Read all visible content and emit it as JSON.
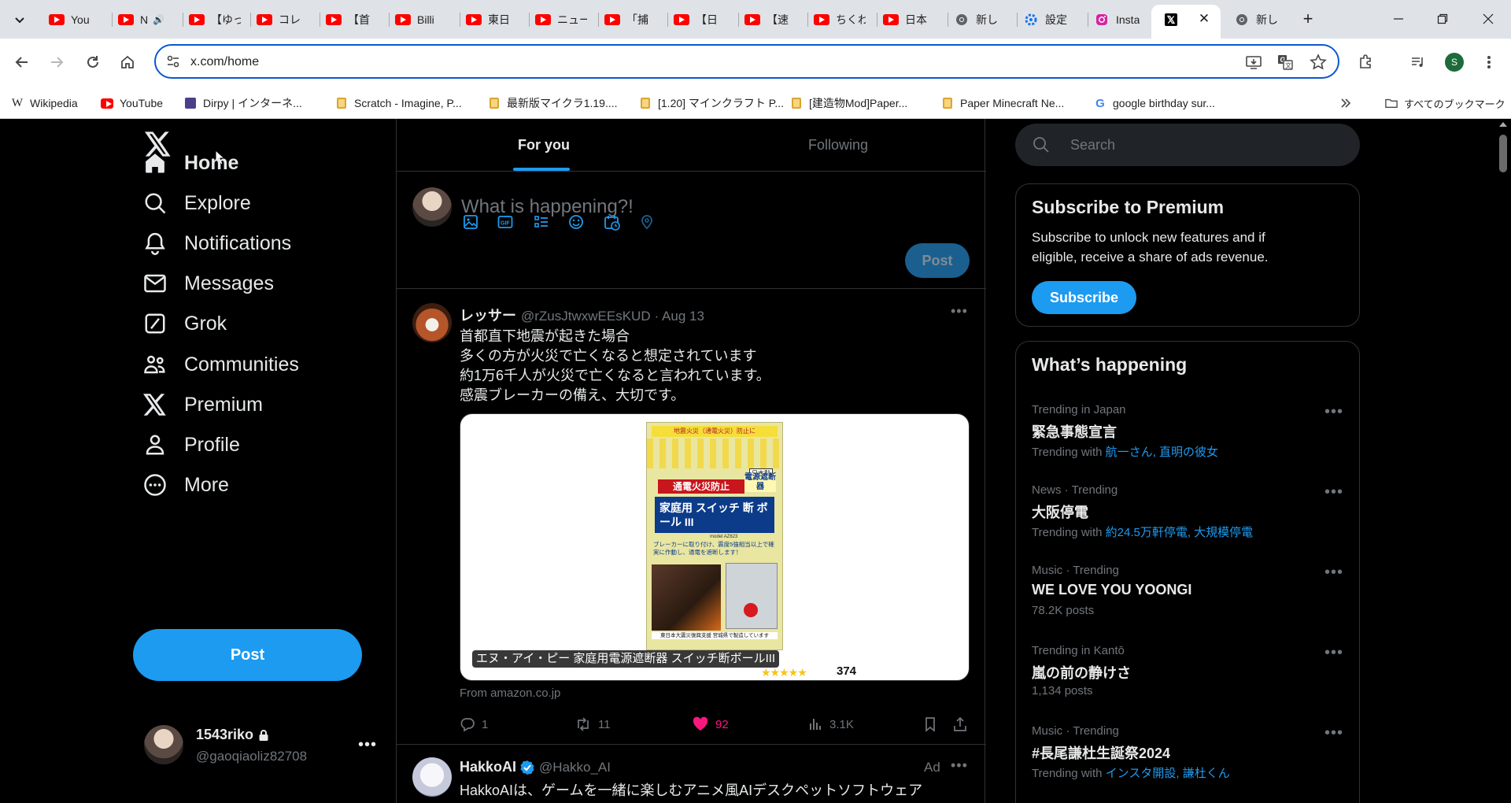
{
  "browser": {
    "tabs": [
      {
        "icon": "youtube-icon",
        "label": "You"
      },
      {
        "icon": "youtube-icon",
        "label": "N"
      },
      {
        "icon": "youtube-icon",
        "label": "【ゆっ"
      },
      {
        "icon": "youtube-icon",
        "label": "コレ"
      },
      {
        "icon": "youtube-icon",
        "label": "【首"
      },
      {
        "icon": "youtube-icon",
        "label": "Billi"
      },
      {
        "icon": "youtube-icon",
        "label": "東日"
      },
      {
        "icon": "youtube-icon",
        "label": "ニュー"
      },
      {
        "icon": "youtube-icon",
        "label": "「捕"
      },
      {
        "icon": "youtube-icon",
        "label": "【日"
      },
      {
        "icon": "youtube-icon",
        "label": "【速"
      },
      {
        "icon": "youtube-icon",
        "label": "ちくわ"
      },
      {
        "icon": "youtube-icon",
        "label": "日本"
      },
      {
        "icon": "chrome-icon",
        "label": "新し"
      },
      {
        "icon": "settings-icon",
        "label": "設定"
      },
      {
        "icon": "instagram-icon",
        "label": "Insta"
      },
      {
        "icon": "x-logo-icon",
        "label": ""
      },
      {
        "icon": "chrome-icon",
        "label": "新し"
      }
    ],
    "url": "x.com/home",
    "profile_initial": "S",
    "bookmarks": [
      {
        "icon": "wikipedia-icon",
        "label": "Wikipedia"
      },
      {
        "icon": "youtube-icon",
        "label": "YouTube"
      },
      {
        "icon": "dirpy-icon",
        "label": "Dirpy | インターネ..."
      },
      {
        "icon": "lock-icon",
        "label": "Scratch - Imagine, P..."
      },
      {
        "icon": "lock-icon",
        "label": "最新版マイクラ1.19...."
      },
      {
        "icon": "lock-icon",
        "label": "[1.20] マインクラフト P..."
      },
      {
        "icon": "lock-icon",
        "label": "[建造物Mod]Paper..."
      },
      {
        "icon": "lock-icon",
        "label": "Paper Minecraft Ne..."
      },
      {
        "icon": "google-icon",
        "label": "google birthday sur..."
      }
    ],
    "all_bookmarks": "すべてのブックマーク"
  },
  "sidebar": {
    "items": [
      {
        "icon": "home-icon",
        "label": "Home"
      },
      {
        "icon": "explore-icon",
        "label": "Explore"
      },
      {
        "icon": "notifications-icon",
        "label": "Notifications"
      },
      {
        "icon": "messages-icon",
        "label": "Messages"
      },
      {
        "icon": "grok-icon",
        "label": "Grok"
      },
      {
        "icon": "communities-icon",
        "label": "Communities"
      },
      {
        "icon": "premium-icon",
        "label": "Premium"
      },
      {
        "icon": "profile-icon",
        "label": "Profile"
      },
      {
        "icon": "more-icon",
        "label": "More"
      }
    ],
    "post_label": "Post",
    "account": {
      "name": "1543riko",
      "handle": "@gaoqiaoliz82708"
    }
  },
  "timeline": {
    "tabs": [
      {
        "label": "For you",
        "active": true
      },
      {
        "label": "Following",
        "active": false
      }
    ],
    "compose_placeholder": "What is happening?!",
    "post_label": "Post",
    "tweets": [
      {
        "name": "レッサー",
        "handle": "@rZusJtwxwEEsKUD",
        "date": "· Aug 13",
        "lines": [
          "首都直下地震が起きた場合",
          "多くの方が火災で亡くなると想定されています",
          "約1万6千人が火災で亡くなると言われています。",
          "感震ブレーカーの備え、大切です。"
        ],
        "card": {
          "caption": "エヌ・アイ・ピー 家庭用電源遮断器 スイッチ断ボールIII",
          "review_count": "374",
          "source": "From amazon.co.jp",
          "product_text": {
            "top": "地震火災（通電火災）防止に",
            "red": "通電火災防止",
            "brand": "日本製",
            "main": "家庭用 スイッチ 断 ボール III",
            "side": "電源遮断器",
            "model": "model AZ623",
            "desc": "ブレーカーに取り付け、震度5強相当以上で確実に作動し、通電を遮断します！",
            "bottom": "東日本大震災復興支援 宮城県で製造しています"
          }
        },
        "stats": {
          "replies": "1",
          "reposts": "11",
          "likes": "92",
          "views": "3.1K"
        }
      },
      {
        "name": "HakkoAI",
        "handle": "@Hakko_AI",
        "ad": "Ad",
        "lines": [
          "HakkoAIは、ゲームを一緒に楽しむアニメ風AIデスクペットソフトウェア"
        ]
      }
    ]
  },
  "right": {
    "search_placeholder": "Search",
    "premium": {
      "title": "Subscribe to Premium",
      "body_line1": "Subscribe to unlock new features and if",
      "body_line2": "eligible, receive a share of ads revenue.",
      "button": "Subscribe"
    },
    "whats_happening": {
      "title": "What’s happening",
      "trends": [
        {
          "meta": "Trending in Japan",
          "title": "緊急事態宣言",
          "sub_prefix": "Trending with ",
          "sub_link": "航一さん, 直明の彼女"
        },
        {
          "meta": "News · Trending",
          "title": "大阪停電",
          "sub_prefix": "Trending with ",
          "sub_link": "約24.5万軒停電, 大規模停電"
        },
        {
          "meta": "Music · Trending",
          "title": "WE LOVE YOU YOONGI",
          "sub_prefix": "78.2K posts",
          "sub_link": ""
        },
        {
          "meta": "Trending in Kantō",
          "title": "嵐の前の静けさ",
          "sub_prefix": "1,134 posts",
          "sub_link": ""
        },
        {
          "meta": "Music · Trending",
          "title": "#長尾謙杜生誕祭2024",
          "sub_prefix": "Trending with ",
          "sub_link": "インスタ開設, 謙杜くん"
        }
      ]
    }
  },
  "colors": {
    "accent": "#1d9bf0",
    "like": "#f91880",
    "background": "#000000",
    "border": "#2f3336",
    "muted": "#71767b"
  }
}
